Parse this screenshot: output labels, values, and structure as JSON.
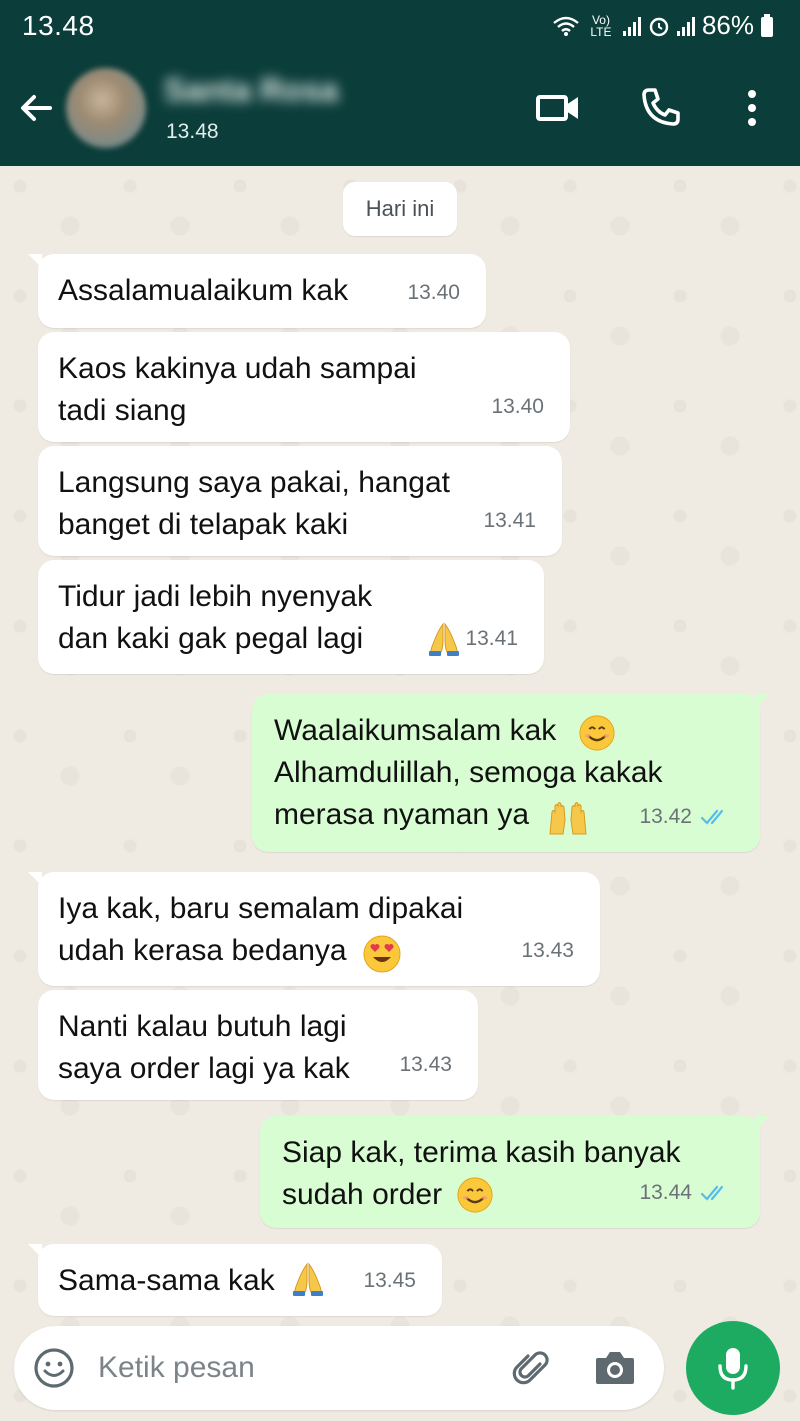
{
  "status_bar": {
    "time": "13.48",
    "network_label": "Vo) LTE",
    "battery": "86%"
  },
  "header": {
    "contact_name": "Santa Rosa",
    "last_seen": "13.48",
    "icons": [
      "back-arrow-icon",
      "video-call-icon",
      "voice-call-icon",
      "more-options-icon"
    ]
  },
  "chat": {
    "date_chip": "Hari ini",
    "messages": [
      {
        "direction": "in",
        "text": "Assalamualaikum kak",
        "time": "13.40"
      },
      {
        "direction": "in",
        "text": "Kaos kakinya udah sampai\ntadi siang",
        "time": "13.40"
      },
      {
        "direction": "in",
        "text": "Langsung saya pakai, hangat\nbanget di telapak kaki",
        "time": "13.41"
      },
      {
        "direction": "in",
        "text": "Tidur jadi lebih nyenyak\ndan kaki gak pegal lagi",
        "emoji": "folded-hands",
        "time": "13.41"
      },
      {
        "direction": "out",
        "text": "Waalaikumsalam kak\nAlhamdulillah, semoga kakak\nmerasa nyaman ya",
        "emoji": [
          "smiling-face",
          "raising-hands"
        ],
        "time": "13.42",
        "status": "read"
      },
      {
        "direction": "in",
        "text": "Iya kak, baru semalam dipakai\nudah kerasa bedanya",
        "emoji": "heart-eyes",
        "time": "13.43"
      },
      {
        "direction": "in",
        "text": "Nanti kalau butuh lagi\nsaya order lagi ya kak",
        "time": "13.43"
      },
      {
        "direction": "out",
        "text": "Siap kak, terima kasih banyak\nsudah order",
        "emoji": "smiling-face",
        "time": "13.44",
        "status": "read"
      },
      {
        "direction": "in",
        "text": "Sama-sama kak",
        "emoji": "folded-hands",
        "time": "13.45"
      }
    ]
  },
  "composer": {
    "placeholder": "Ketik pesan",
    "icons": [
      "emoji-icon",
      "attach-icon",
      "camera-icon",
      "mic-icon"
    ]
  },
  "colors": {
    "header_bg": "#0b3d3a",
    "chat_bg": "#efeae2",
    "incoming_bubble": "#ffffff",
    "outgoing_bubble": "#d9fdd3",
    "read_tick": "#53bdeb",
    "mic_button": "#1daa61"
  }
}
